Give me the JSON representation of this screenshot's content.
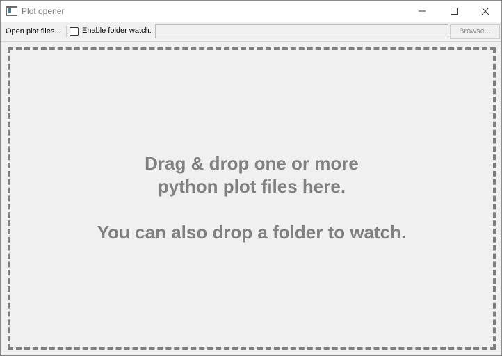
{
  "window": {
    "title": "Plot opener"
  },
  "toolbar": {
    "open_label": "Open plot files...",
    "folder_watch_label": "Enable folder watch:",
    "folder_watch_checked": false,
    "folder_path_value": "",
    "browse_label": "Browse..."
  },
  "drop_zone": {
    "line1": "Drag & drop one or more",
    "line2": "python plot files here.",
    "line3": "You can also drop a folder to watch."
  },
  "colors": {
    "drop_text": "#808080",
    "dash_border": "#7f7f7f",
    "background": "#f0f0f0"
  },
  "icons": {
    "app": "plot-window-icon",
    "minimize": "minimize-icon",
    "maximize": "maximize-icon",
    "close": "close-icon"
  }
}
